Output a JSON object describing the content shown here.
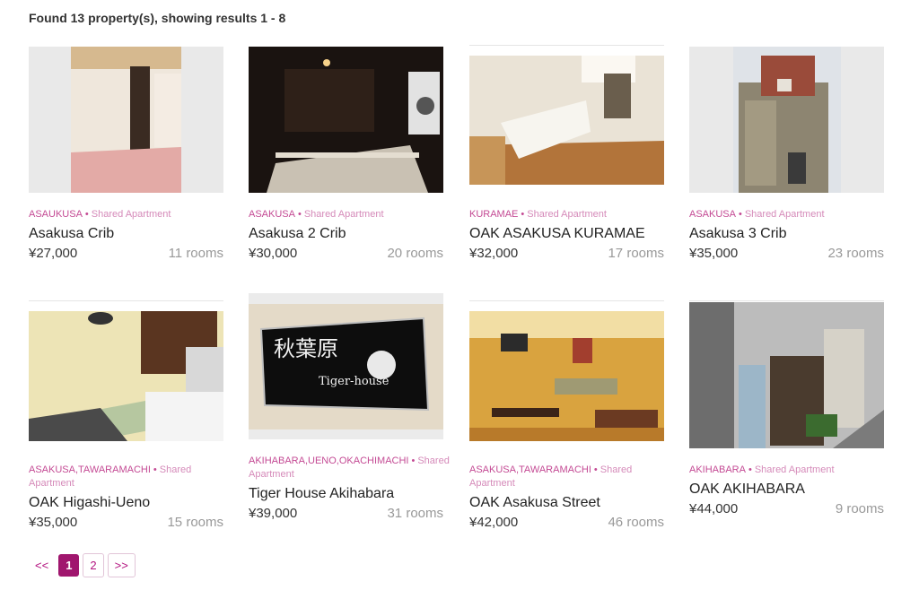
{
  "summary": "Found 13 property(s), showing results 1 - 8",
  "cards": [
    {
      "area": "ASAUKUSA",
      "type": "Shared Apartment",
      "title": "Asakusa Crib",
      "price": "¥27,000",
      "rooms": "11 rooms"
    },
    {
      "area": "ASAKUSA",
      "type": "Shared Apartment",
      "title": "Asakusa 2 Crib",
      "price": "¥30,000",
      "rooms": "20 rooms"
    },
    {
      "area": "KURAMAE",
      "type": "Shared Apartment",
      "title": "OAK ASAKUSA KURAMAE",
      "price": "¥32,000",
      "rooms": "17 rooms"
    },
    {
      "area": "ASAKUSA",
      "type": "Shared Apartment",
      "title": "Asakusa 3 Crib",
      "price": "¥35,000",
      "rooms": "23 rooms"
    },
    {
      "area": "ASAKUSA,TAWARAMACHI",
      "type": "Shared Apartment",
      "title": "OAK Higashi-Ueno",
      "price": "¥35,000",
      "rooms": "15 rooms"
    },
    {
      "area": "AKIHABARA,UENO,OKACHIMACHI",
      "type": "Shared Apartment",
      "title": "Tiger House Akihabara",
      "price": "¥39,000",
      "rooms": "31 rooms",
      "sign_kanji": "秋葉原",
      "sign_text": "Tiger-house"
    },
    {
      "area": "ASAKUSA,TAWARAMACHI",
      "type": "Shared Apartment",
      "title": "OAK Asakusa Street",
      "price": "¥42,000",
      "rooms": "46 rooms"
    },
    {
      "area": "AKIHABARA",
      "type": "Shared Apartment",
      "title": "OAK AKIHABARA",
      "price": "¥44,000",
      "rooms": "9 rooms"
    }
  ],
  "pager": {
    "prev": "<<",
    "pages": [
      "1",
      "2"
    ],
    "next": ">>",
    "current": "1"
  },
  "colors": {
    "accent": "#a0166e",
    "meta": "#c44a94"
  }
}
